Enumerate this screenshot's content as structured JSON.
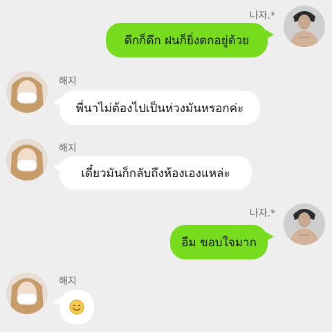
{
  "colors": {
    "background": "#eeeeef",
    "outgoing_bubble": "#78dc1e",
    "incoming_bubble": "#ffffff"
  },
  "messages": [
    {
      "direction": "outgoing",
      "sender": "나자.*",
      "text": "ดึกก็ดึก ฝนก็ยิ่งตกอยู่ด้วย",
      "avatar": "male-avatar"
    },
    {
      "direction": "incoming",
      "sender": "해지",
      "text": "พี่นาไม่ต้องไปเป็นห่วงมันหรอกค่ะ",
      "avatar": "female-masked-avatar"
    },
    {
      "direction": "incoming",
      "sender": "해지",
      "text": "เดี๋ยวมันก็กลับถึงห้องเองแหล่ะ",
      "avatar": "female-masked-avatar"
    },
    {
      "direction": "outgoing",
      "sender": "나자.*",
      "text": "อืม ขอบใจมาก",
      "avatar": "male-avatar"
    },
    {
      "direction": "incoming",
      "sender": "해지",
      "text": "",
      "emoji": "smiling-face-emoji",
      "avatar": "female-masked-avatar"
    }
  ]
}
